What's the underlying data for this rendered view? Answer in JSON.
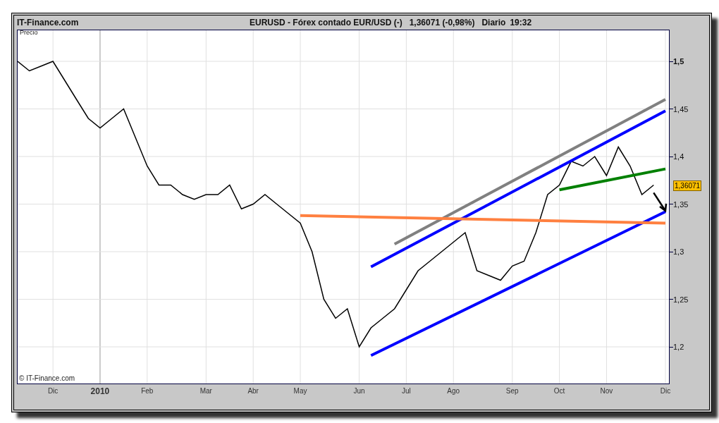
{
  "header": {
    "site": "IT-Finance.com",
    "title": "EURUSD - Fórex contado EUR/USD (-)",
    "quote": "1,36071 (-0,98%)",
    "period": "Diario",
    "time": "19:32"
  },
  "plot": {
    "copyright": "© IT-Finance.com",
    "last_price": "1,36071",
    "chart_data": {
      "type": "line",
      "ylabel": "Precio",
      "ylim": [
        1.1615,
        1.5326
      ],
      "grid": true,
      "yticks": [
        {
          "value": 1.5,
          "label": "1,5"
        },
        {
          "value": 1.45,
          "label": "1,45"
        },
        {
          "value": 1.4,
          "label": "1,4"
        },
        {
          "value": 1.35,
          "label": "1,35"
        },
        {
          "value": 1.3,
          "label": "1,3"
        },
        {
          "value": 1.25,
          "label": "1,25"
        },
        {
          "value": 1.2,
          "label": "1,2"
        }
      ],
      "categories": [
        null,
        null,
        null,
        "Dic",
        null,
        null,
        null,
        "2010",
        null,
        null,
        null,
        "Feb",
        null,
        null,
        null,
        null,
        "Mar",
        null,
        null,
        null,
        "Abr",
        null,
        null,
        null,
        "May",
        null,
        null,
        null,
        null,
        "Jun",
        null,
        null,
        null,
        "Jul",
        null,
        null,
        null,
        "Ago",
        null,
        null,
        null,
        null,
        "Sep",
        null,
        null,
        null,
        "Oct",
        null,
        null,
        null,
        "Nov",
        null,
        null,
        null,
        null,
        "Dic"
      ],
      "series": [
        {
          "color": "#000000",
          "values": [
            1.5,
            1.49,
            1.495,
            1.5,
            1.48,
            1.46,
            1.44,
            1.43,
            1.44,
            1.45,
            1.42,
            1.39,
            1.37,
            1.37,
            1.36,
            1.355,
            1.36,
            1.36,
            1.37,
            1.345,
            1.35,
            1.36,
            1.35,
            1.34,
            1.33,
            1.3,
            1.25,
            1.23,
            1.24,
            1.2,
            1.22,
            1.23,
            1.24,
            1.26,
            1.28,
            1.29,
            1.3,
            1.31,
            1.32,
            1.28,
            1.275,
            1.27,
            1.285,
            1.29,
            1.32,
            1.36,
            1.37,
            1.395,
            1.39,
            1.4,
            1.38,
            1.41,
            1.39,
            1.36,
            1.37,
            null
          ]
        },
        {
          "color": "#808080",
          "values": [
            null,
            null,
            null,
            null,
            null,
            null,
            null,
            null,
            null,
            null,
            null,
            null,
            null,
            null,
            null,
            null,
            null,
            null,
            null,
            null,
            null,
            null,
            null,
            null,
            null,
            null,
            null,
            null,
            null,
            null,
            null,
            null,
            1.308,
            null,
            null,
            null,
            null,
            null,
            null,
            null,
            null,
            null,
            null,
            null,
            null,
            null,
            null,
            null,
            null,
            null,
            null,
            null,
            null,
            null,
            null,
            1.46
          ]
        },
        {
          "color": "#0000ff",
          "values": [
            null,
            null,
            null,
            null,
            null,
            null,
            null,
            null,
            null,
            null,
            null,
            null,
            null,
            null,
            null,
            null,
            null,
            null,
            null,
            null,
            null,
            null,
            null,
            null,
            null,
            null,
            null,
            null,
            null,
            null,
            1.284,
            null,
            null,
            null,
            null,
            null,
            null,
            null,
            null,
            null,
            null,
            null,
            null,
            null,
            null,
            null,
            null,
            null,
            null,
            null,
            null,
            null,
            null,
            null,
            null,
            1.448
          ]
        },
        {
          "color": "#0000ff",
          "values": [
            null,
            null,
            null,
            null,
            null,
            null,
            null,
            null,
            null,
            null,
            null,
            null,
            null,
            null,
            null,
            null,
            null,
            null,
            null,
            null,
            null,
            null,
            null,
            null,
            null,
            null,
            null,
            null,
            null,
            null,
            1.191,
            null,
            null,
            null,
            null,
            null,
            null,
            null,
            null,
            null,
            null,
            null,
            null,
            null,
            null,
            null,
            null,
            null,
            null,
            null,
            null,
            null,
            null,
            null,
            null,
            1.342
          ]
        },
        {
          "color": "#ff8040",
          "values": [
            null,
            null,
            null,
            null,
            null,
            null,
            null,
            null,
            null,
            null,
            null,
            null,
            null,
            null,
            null,
            null,
            null,
            null,
            null,
            null,
            null,
            null,
            null,
            null,
            1.338,
            null,
            null,
            null,
            null,
            null,
            null,
            null,
            null,
            null,
            null,
            null,
            null,
            null,
            null,
            null,
            null,
            null,
            null,
            null,
            null,
            null,
            null,
            null,
            null,
            null,
            null,
            null,
            null,
            null,
            null,
            1.33
          ]
        },
        {
          "color": "#008000",
          "values": [
            null,
            null,
            null,
            null,
            null,
            null,
            null,
            null,
            null,
            null,
            null,
            null,
            null,
            null,
            null,
            null,
            null,
            null,
            null,
            null,
            null,
            null,
            null,
            null,
            null,
            null,
            null,
            null,
            null,
            null,
            null,
            null,
            null,
            null,
            null,
            null,
            null,
            null,
            null,
            null,
            null,
            null,
            null,
            null,
            null,
            null,
            1.365,
            null,
            null,
            null,
            null,
            null,
            null,
            null,
            null,
            1.387
          ]
        }
      ]
    }
  }
}
